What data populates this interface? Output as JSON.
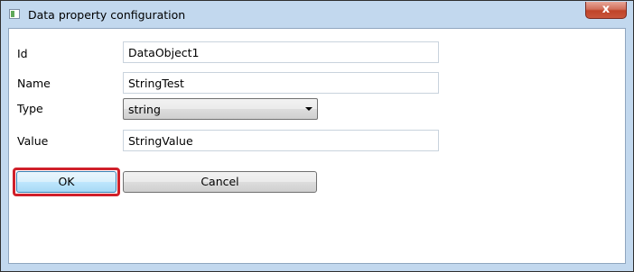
{
  "window": {
    "title": "Data property configuration",
    "close_label": "x"
  },
  "form": {
    "id_label": "Id",
    "id_value": "DataObject1",
    "name_label": "Name",
    "name_value": "StringTest",
    "type_label": "Type",
    "type_value": "string",
    "value_label": "Value",
    "value_value": "StringValue"
  },
  "buttons": {
    "ok_label": "OK",
    "cancel_label": "Cancel"
  },
  "colors": {
    "highlight": "#d0202a",
    "frame": "#c2d8ee"
  }
}
